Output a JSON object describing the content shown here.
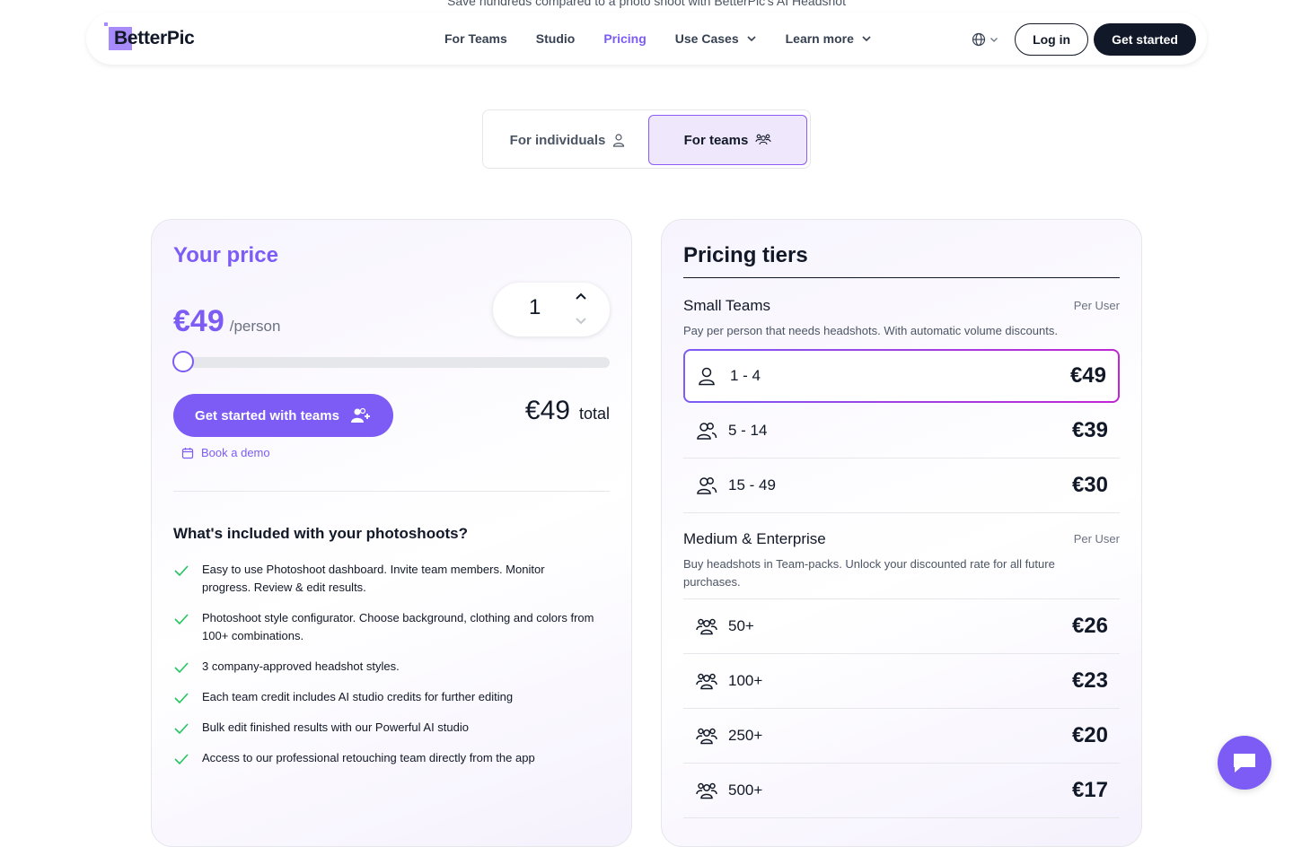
{
  "page_behind_text": "Save hundreds compared to a photo shoot with BetterPic's AI Headshot",
  "nav": {
    "logo": "BetterPic",
    "links": [
      {
        "label": "For Teams",
        "active": false,
        "dropdown": false
      },
      {
        "label": "Studio",
        "active": false,
        "dropdown": false
      },
      {
        "label": "Pricing",
        "active": true,
        "dropdown": false
      },
      {
        "label": "Use Cases",
        "active": false,
        "dropdown": true
      },
      {
        "label": "Learn more",
        "active": false,
        "dropdown": true
      }
    ],
    "language_icon": "globe-icon",
    "login_label": "Log in",
    "get_started_label": "Get started"
  },
  "toggle": {
    "individuals_label": "For individuals",
    "teams_label": "For teams",
    "selected": "teams"
  },
  "your_price": {
    "title": "Your price",
    "price": "€49",
    "unit": "/person",
    "quantity": "1",
    "slider_value_fraction": 0.0,
    "cta_label": "Get started with teams",
    "total_value": "€49",
    "total_label": "total",
    "book_demo_label": "Book a demo",
    "included_title": "What's included with your photoshoots?",
    "features": [
      "Easy to use Photoshoot dashboard. Invite team members. Monitor progress. Review & edit results.",
      "Photoshoot style configurator. Choose background, clothing and colors from 100+ combinations.",
      "3 company-approved headshot styles.",
      "Each team credit includes AI studio credits for further editing",
      "Bulk edit finished results with our Powerful AI studio",
      "Access to our professional retouching team directly from the app"
    ]
  },
  "pricing_tiers": {
    "title": "Pricing tiers",
    "small": {
      "name": "Small Teams",
      "per": "Per User",
      "description": "Pay per person that needs headshots. With automatic volume discounts.",
      "tiers": [
        {
          "range": "1 - 4",
          "price": "€49",
          "icon": "person-icon",
          "selected": true
        },
        {
          "range": "5 - 14",
          "price": "€39",
          "icon": "two-people-icon",
          "selected": false
        },
        {
          "range": "15 - 49",
          "price": "€30",
          "icon": "two-people-icon",
          "selected": false
        }
      ]
    },
    "medium": {
      "name": "Medium & Enterprise",
      "per": "Per User",
      "description": "Buy headshots in Team-packs. Unlock your discounted rate for all future purchases.",
      "tiers": [
        {
          "range": "50+",
          "price": "€26",
          "icon": "group-icon"
        },
        {
          "range": "100+",
          "price": "€23",
          "icon": "group-icon"
        },
        {
          "range": "250+",
          "price": "€20",
          "icon": "group-icon"
        },
        {
          "range": "500+",
          "price": "€17",
          "icon": "group-icon"
        }
      ]
    }
  },
  "chat": {
    "icon": "chat-bubble-icon"
  },
  "colors": {
    "accent": "#7c5cf4",
    "dark": "#111827",
    "toggle_selected_bg": "#efe8fd"
  }
}
